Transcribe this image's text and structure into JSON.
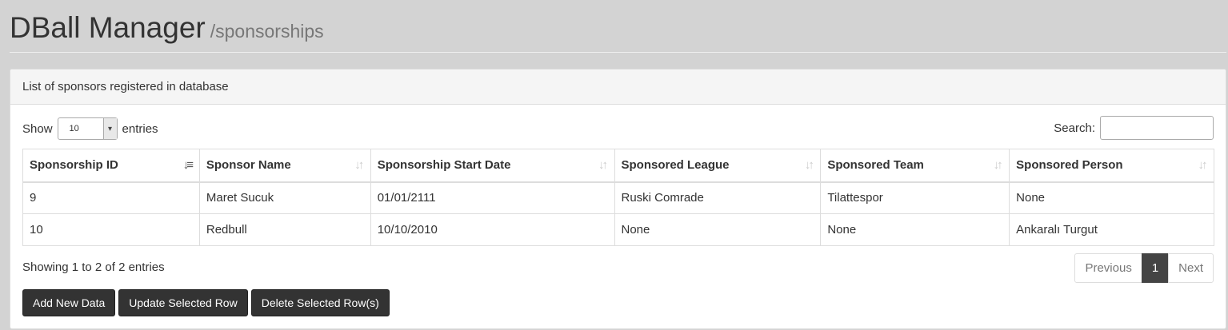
{
  "header": {
    "title": "DBall Manager",
    "subtitle": "/sponsorships"
  },
  "panel": {
    "heading": "List of sponsors registered in database"
  },
  "length_menu": {
    "show_label": "Show",
    "selected": "10",
    "entries_label": "entries"
  },
  "search": {
    "label": "Search:",
    "value": ""
  },
  "table": {
    "columns": [
      {
        "label": "Sponsorship ID",
        "sort": "asc"
      },
      {
        "label": "Sponsor Name",
        "sort": "none"
      },
      {
        "label": "Sponsorship Start Date",
        "sort": "none"
      },
      {
        "label": "Sponsored League",
        "sort": "none"
      },
      {
        "label": "Sponsored Team",
        "sort": "none"
      },
      {
        "label": "Sponsored Person",
        "sort": "none"
      }
    ],
    "rows": [
      [
        "9",
        "Maret Sucuk",
        "01/01/2111",
        "Ruski Comrade",
        "Tilattespor",
        "None"
      ],
      [
        "10",
        "Redbull",
        "10/10/2010",
        "None",
        "None",
        "Ankaralı Turgut"
      ]
    ]
  },
  "info": "Showing 1 to 2 of 2 entries",
  "pagination": {
    "previous": "Previous",
    "current": "1",
    "next": "Next"
  },
  "actions": {
    "add": "Add New Data",
    "update": "Update Selected Row",
    "delete": "Delete Selected Row(s)"
  }
}
